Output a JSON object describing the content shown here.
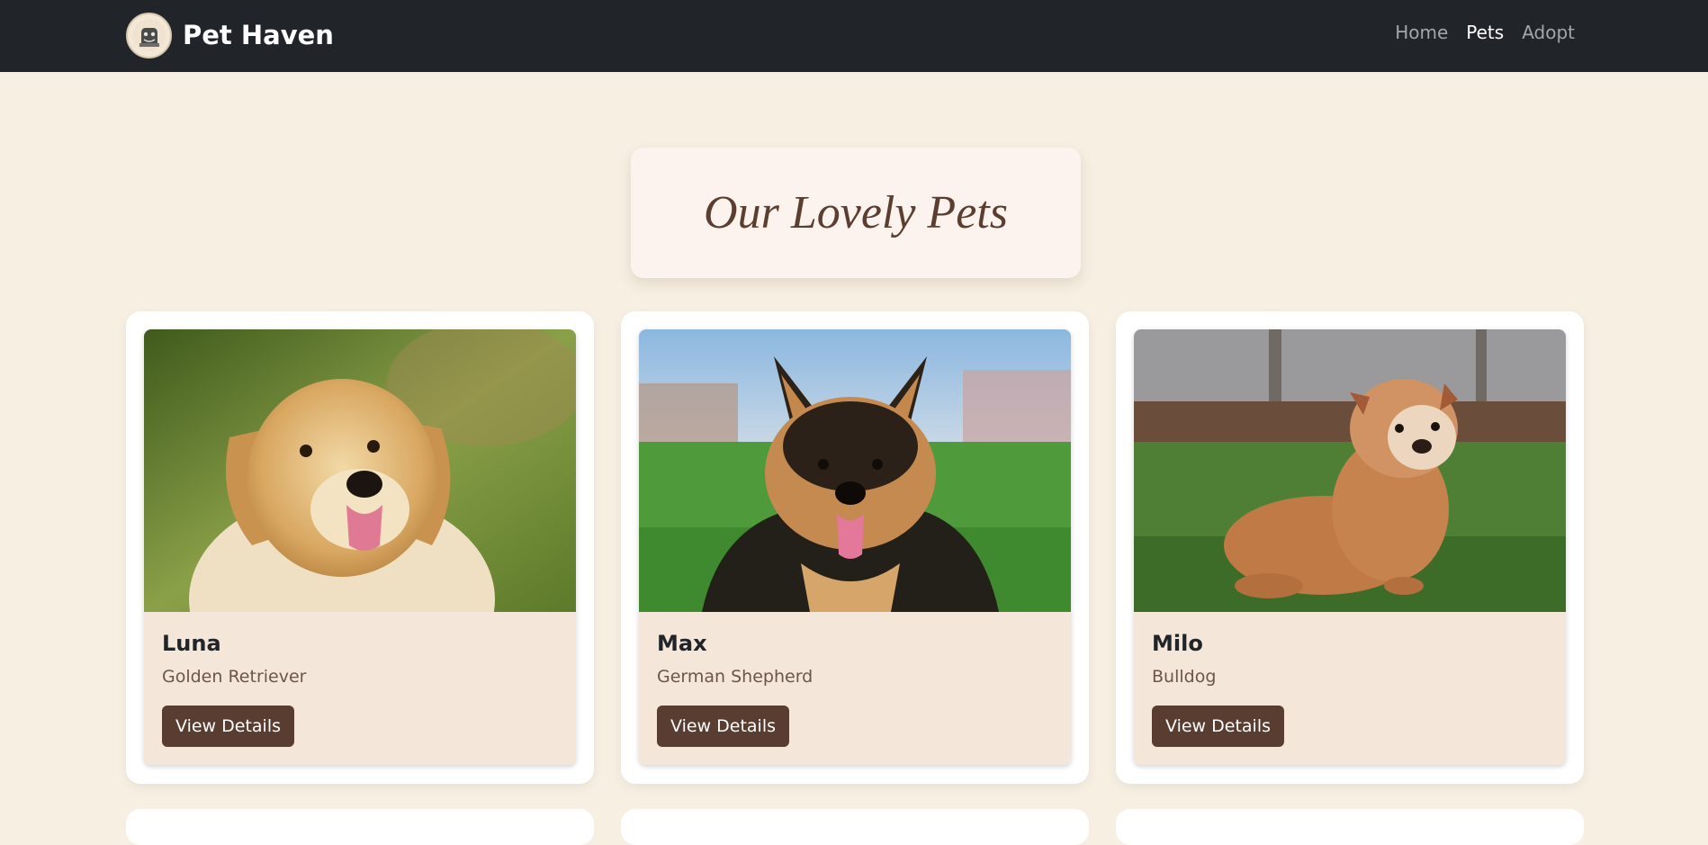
{
  "navbar": {
    "brand": "Pet Haven",
    "links": [
      {
        "label": "Home",
        "active": false
      },
      {
        "label": "Pets",
        "active": true
      },
      {
        "label": "Adopt",
        "active": false
      }
    ]
  },
  "page": {
    "title": "Our Lovely Pets"
  },
  "pets": [
    {
      "name": "Luna",
      "breed": "Golden Retriever",
      "button": "View Details",
      "photo": "golden-retriever-photo"
    },
    {
      "name": "Max",
      "breed": "German Shepherd",
      "button": "View Details",
      "photo": "german-shepherd-photo"
    },
    {
      "name": "Milo",
      "breed": "Bulldog",
      "button": "View Details",
      "photo": "bulldog-photo"
    }
  ],
  "colors": {
    "navbar": "#212529",
    "background": "#f6efe2",
    "accent": "#5a3d31",
    "card_body": "#f4e6d9",
    "title": "#5b3e2f"
  }
}
